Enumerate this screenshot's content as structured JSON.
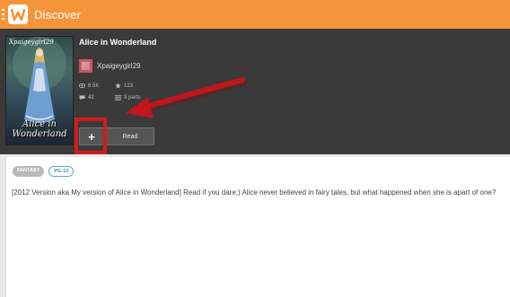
{
  "header": {
    "title": "Discover",
    "accent_color": "#f5953a",
    "logo_letter": "W"
  },
  "story": {
    "title": "Alice in Wonderland",
    "cover": {
      "author_text": "Xpaigeygirl29",
      "title_text": "Alice in Wonderland"
    },
    "author": {
      "name": "Xpaigeygirl29"
    },
    "stats": {
      "views": "6.5K",
      "votes": "123",
      "comments": "42",
      "parts": "9 parts"
    },
    "actions": {
      "add_label": "+",
      "read_label": "Read"
    }
  },
  "details": {
    "tags": {
      "genre": "FANTASY",
      "rating": "PG-13"
    },
    "description": "[2012 Version aka My version of Alice in Wonderland] Read if you dare;) Alice never believed in fairy tales, but what happened when she is apart of one?"
  },
  "annotation": {
    "highlight_color": "#d11b1b"
  }
}
